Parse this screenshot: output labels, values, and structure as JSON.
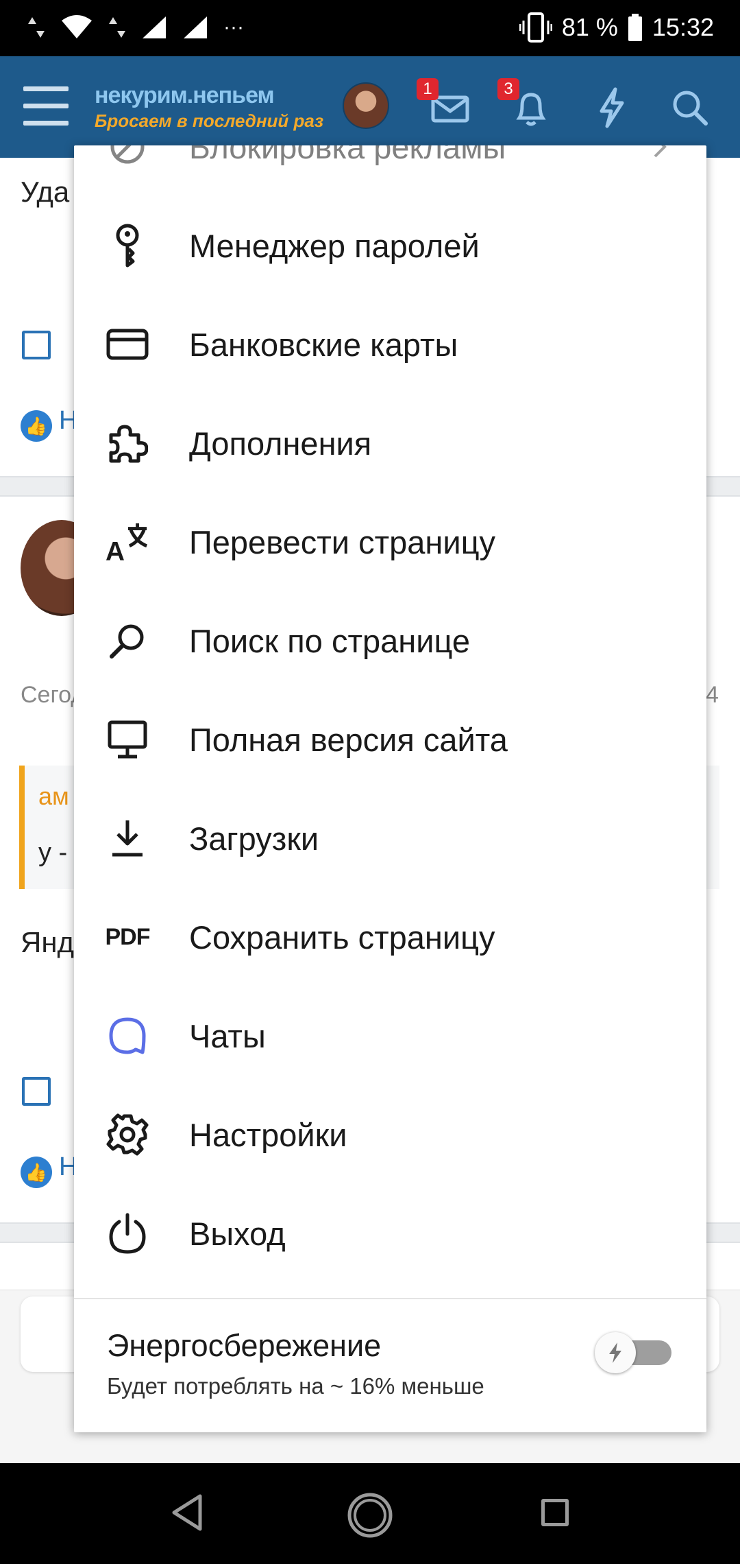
{
  "status_bar": {
    "battery_percent": "81 %",
    "time": "15:32",
    "more": "···"
  },
  "header": {
    "logo_line1": "некурим.непьем",
    "logo_line2": "Бросаем в последний раз",
    "messages_badge": "1",
    "alerts_badge": "3"
  },
  "background": {
    "text1": "Уда",
    "text2": "Н",
    "text3": "Сегод",
    "text4": "4",
    "text5": "ам",
    "text6": "у -",
    "text7": "Янд",
    "text8": "Н"
  },
  "menu": {
    "items": [
      {
        "label": "Блокировка рекламы",
        "icon": "block-icon"
      },
      {
        "label": "Менеджер паролей",
        "icon": "key-icon"
      },
      {
        "label": "Банковские карты",
        "icon": "card-icon"
      },
      {
        "label": "Дополнения",
        "icon": "puzzle-icon"
      },
      {
        "label": "Перевести страницу",
        "icon": "translate-icon"
      },
      {
        "label": "Поиск по странице",
        "icon": "search-icon"
      },
      {
        "label": "Полная версия сайта",
        "icon": "desktop-icon"
      },
      {
        "label": "Загрузки",
        "icon": "download-icon"
      },
      {
        "label": "Сохранить страницу",
        "icon": "pdf-icon"
      },
      {
        "label": "Чаты",
        "icon": "chat-icon"
      },
      {
        "label": "Настройки",
        "icon": "gear-icon"
      },
      {
        "label": "Выход",
        "icon": "power-icon"
      }
    ],
    "pdf_icon_text": "PDF",
    "power_saving": {
      "title": "Энергосбережение",
      "subtitle": "Будет потреблять на ~ 16% меньше",
      "enabled": false
    }
  },
  "colors": {
    "header_bg": "#1e5a8b",
    "badge": "#e0262e",
    "chat_icon": "#5b6ee6"
  }
}
